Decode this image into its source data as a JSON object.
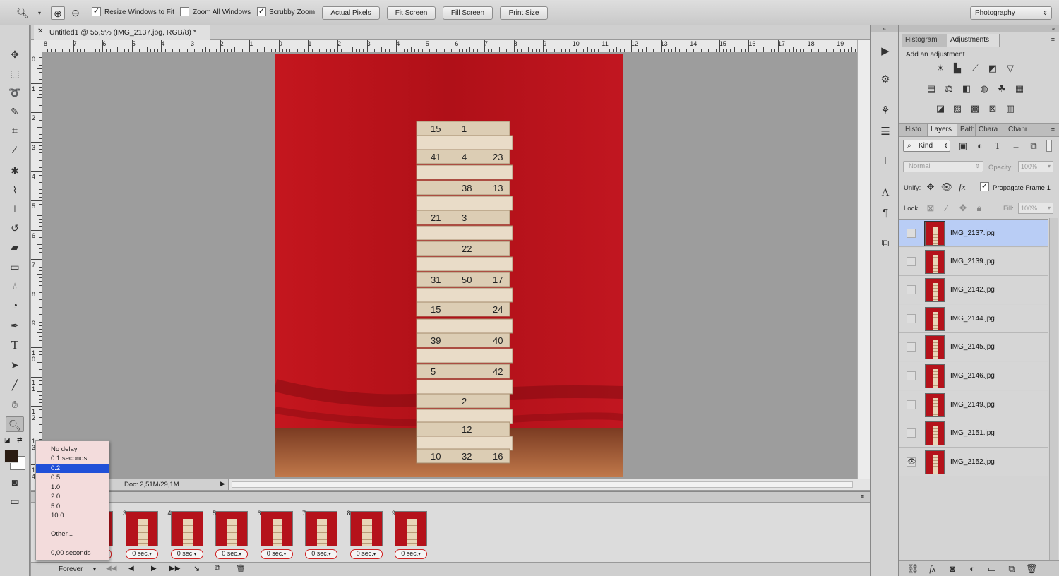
{
  "options_bar": {
    "resize_windows_label": "Resize Windows to Fit",
    "zoom_all_label": "Zoom All Windows",
    "scrubby_zoom_label": "Scrubby Zoom",
    "actual_pixels": "Actual Pixels",
    "fit_screen": "Fit Screen",
    "fill_screen": "Fill Screen",
    "print_size": "Print Size",
    "workspace": "Photography"
  },
  "document": {
    "tab_title": "Untitled1 @ 55,5% (IMG_2137.jpg, RGB/8) *",
    "status": "Doc: 2,51M/29,1M",
    "h_ruler": [
      "8",
      "7",
      "6",
      "5",
      "4",
      "3",
      "2",
      "1",
      "0",
      "1",
      "2",
      "3",
      "4",
      "5",
      "6",
      "7",
      "8",
      "9",
      "10",
      "11",
      "12",
      "13",
      "14",
      "15",
      "16",
      "17",
      "18",
      "19"
    ],
    "v_ruler": [
      "0",
      "1",
      "2",
      "3",
      "4",
      "5",
      "6",
      "7",
      "8",
      "9",
      "1\n0",
      "1\n1",
      "1\n2",
      "1\n3",
      "1\n4"
    ]
  },
  "timeline": {
    "frames": [
      {
        "num": "3",
        "delay": "0 sec."
      },
      {
        "num": "4",
        "delay": "0 sec."
      },
      {
        "num": "5",
        "delay": "0 sec."
      },
      {
        "num": "6",
        "delay": "0 sec."
      },
      {
        "num": "7",
        "delay": "0 sec."
      },
      {
        "num": "8",
        "delay": "0 sec."
      },
      {
        "num": "9",
        "delay": "0 sec."
      }
    ],
    "loop": "Forever"
  },
  "delay_menu": {
    "items": [
      "No delay",
      "0.1 seconds",
      "0.2",
      "0.5",
      "1.0",
      "2.0",
      "5.0",
      "10.0",
      "Other...",
      "0,00 seconds"
    ],
    "selected": "0.2"
  },
  "adjustments_panel": {
    "tab_histogram": "Histogram",
    "tab_adjustments": "Adjustments",
    "heading": "Add an adjustment"
  },
  "layers_panel": {
    "tabs": [
      "Histo",
      "Layers",
      "Paths",
      "Chara",
      "Chanr"
    ],
    "kind_label": "Kind",
    "blend_mode": "Normal",
    "opacity_label": "Opacity:",
    "opacity_value": "100%",
    "unify_label": "Unify:",
    "propagate_label": "Propagate Frame 1",
    "lock_label": "Lock:",
    "fill_label": "Fill:",
    "fill_value": "100%",
    "layers": [
      {
        "name": "IMG_2137.jpg",
        "visible": false,
        "active": true
      },
      {
        "name": "IMG_2139.jpg",
        "visible": false,
        "active": false
      },
      {
        "name": "IMG_2142.jpg",
        "visible": false,
        "active": false
      },
      {
        "name": "IMG_2144.jpg",
        "visible": false,
        "active": false
      },
      {
        "name": "IMG_2145.jpg",
        "visible": false,
        "active": false
      },
      {
        "name": "IMG_2146.jpg",
        "visible": false,
        "active": false
      },
      {
        "name": "IMG_2149.jpg",
        "visible": false,
        "active": false
      },
      {
        "name": "IMG_2151.jpg",
        "visible": false,
        "active": false
      },
      {
        "name": "IMG_2152.jpg",
        "visible": true,
        "active": false
      }
    ]
  },
  "colors": {
    "accent": "#2050d8",
    "canvas_red": "#b5121b",
    "selected_layer": "#b9cdf5"
  }
}
